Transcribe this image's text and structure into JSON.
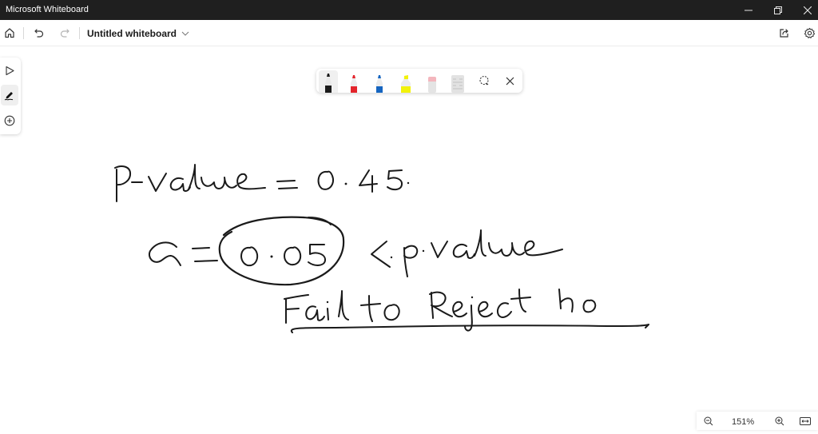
{
  "window": {
    "title": "Microsoft Whiteboard",
    "controls": [
      "minimize",
      "restore",
      "close"
    ]
  },
  "appbar": {
    "home_icon": "home-icon",
    "undo_icon": "undo-icon",
    "redo_icon": "redo-icon",
    "document_title": "Untitled whiteboard",
    "title_dropdown_icon": "chevron-down-icon",
    "share_icon": "share-icon",
    "settings_icon": "gear-icon"
  },
  "left_toolbar": {
    "items": [
      {
        "name": "select",
        "icon": "pointer-icon",
        "active": false
      },
      {
        "name": "inking",
        "icon": "pen-icon",
        "active": true
      },
      {
        "name": "add",
        "icon": "plus-circle-icon",
        "active": false
      }
    ]
  },
  "pen_tray": {
    "pens": [
      {
        "name": "black-pen",
        "color": "#1a1a1a",
        "active": true
      },
      {
        "name": "red-pen",
        "color": "#e3242b",
        "active": false
      },
      {
        "name": "blue-pen",
        "color": "#1565c0",
        "active": false
      },
      {
        "name": "yellow-highlighter",
        "color": "#f2f20a",
        "active": false
      },
      {
        "name": "eraser",
        "color": "#f4b6bd",
        "active": false
      },
      {
        "name": "ruler",
        "color": "#d8d8d8",
        "active": false
      }
    ],
    "lasso_icon": "lasso-icon",
    "close_icon": "close-icon"
  },
  "canvas": {
    "handwriting": [
      "P-value = 0.45.",
      "α = 0.05 < p-value",
      "Fail to Reject Ho"
    ],
    "circled_value": "0.05"
  },
  "zoom": {
    "zoom_out_icon": "zoom-out-icon",
    "level": "151%",
    "zoom_in_icon": "zoom-in-icon",
    "fit_icon": "fit-to-screen-icon"
  }
}
